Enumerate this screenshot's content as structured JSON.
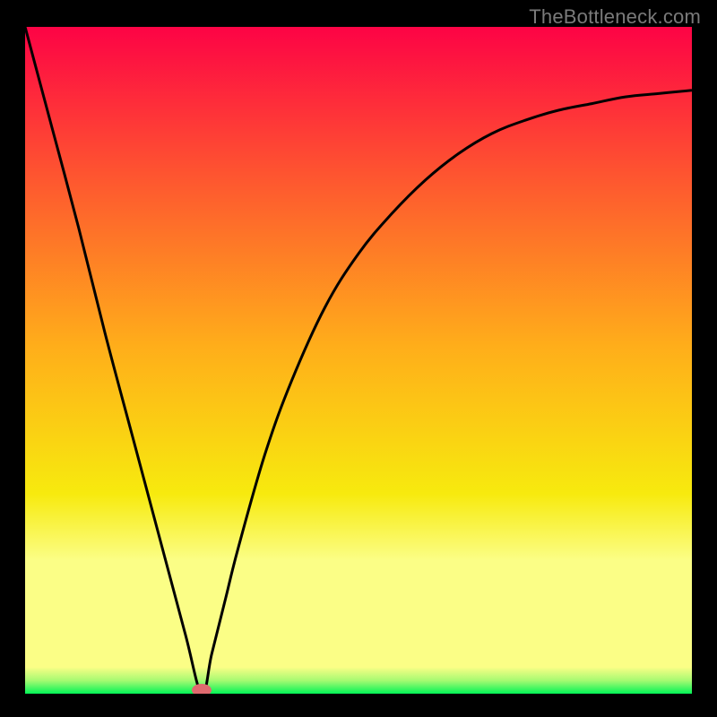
{
  "attribution": "TheBottleneck.com",
  "colors": {
    "top": "#fd0345",
    "mid_upper": "#fe5430",
    "mid": "#ffae1a",
    "mid_lower": "#f7ea0e",
    "pale": "#fbfe86",
    "green": "#02f456",
    "curve": "#000000",
    "marker": "#e06a6f",
    "background": "#000000"
  },
  "chart_data": {
    "type": "line",
    "x": [
      0.0,
      0.04,
      0.08,
      0.12,
      0.16,
      0.2,
      0.24,
      0.265,
      0.28,
      0.3,
      0.32,
      0.36,
      0.4,
      0.45,
      0.5,
      0.55,
      0.6,
      0.65,
      0.7,
      0.75,
      0.8,
      0.85,
      0.9,
      0.95,
      1.0
    ],
    "values": [
      100,
      85,
      70,
      54,
      39,
      24,
      9,
      0,
      6,
      14,
      22,
      36,
      47,
      58,
      66,
      72,
      77,
      81,
      84,
      86,
      87.5,
      88.5,
      89.5,
      90,
      90.5
    ],
    "xlabel": "",
    "ylabel": "",
    "xlim": [
      0,
      1
    ],
    "ylim": [
      0,
      100
    ],
    "title": "",
    "marker": {
      "x": 0.265,
      "y": 0
    },
    "gradient_stops": [
      {
        "pct": 0,
        "color": "#fd0345"
      },
      {
        "pct": 22,
        "color": "#fe5430"
      },
      {
        "pct": 48,
        "color": "#ffae1a"
      },
      {
        "pct": 70,
        "color": "#f7ea0e"
      },
      {
        "pct": 80,
        "color": "#fbfe86"
      },
      {
        "pct": 96,
        "color": "#fbfe86"
      },
      {
        "pct": 98,
        "color": "#a7fa72"
      },
      {
        "pct": 100,
        "color": "#02f456"
      }
    ]
  }
}
